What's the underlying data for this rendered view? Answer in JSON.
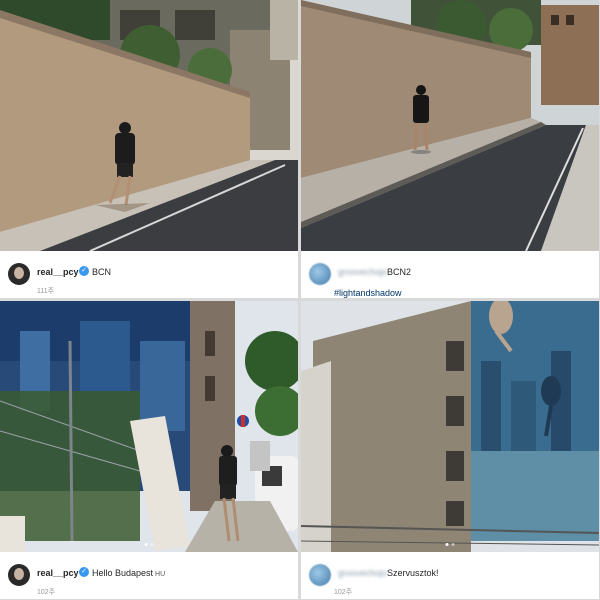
{
  "posts": [
    {
      "username": "real__pcy",
      "verified": true,
      "caption": "BCN",
      "time": "111주"
    },
    {
      "username": "groovechojo",
      "username_blurred": true,
      "caption": "BCN2",
      "hashtag": "#lightandshadow"
    },
    {
      "username": "real__pcy",
      "verified": true,
      "caption": "Hello Budapest",
      "location_tag": "HU",
      "time": "102주"
    },
    {
      "username": "groovechojo",
      "username_blurred": true,
      "caption": "Szervusztok!",
      "time": "102주"
    }
  ],
  "icons": {
    "verified": "verified-check-icon"
  },
  "colors": {
    "verified_badge": "#3897f0",
    "hashtag": "#003569",
    "timestamp": "#999999"
  }
}
